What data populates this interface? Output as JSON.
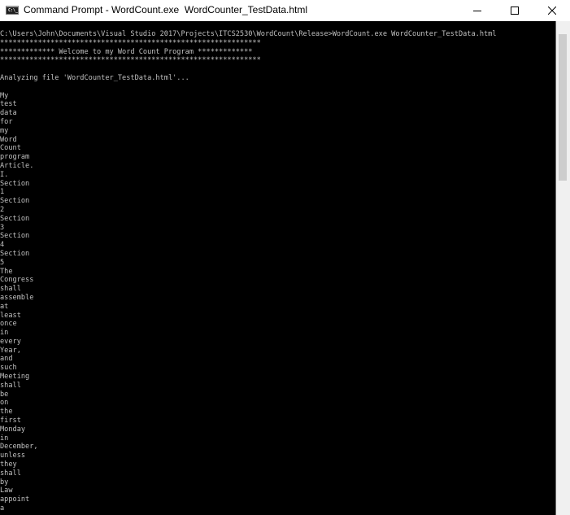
{
  "window": {
    "title": "Command Prompt - WordCount.exe  WordCounter_TestData.html",
    "icon": "cmd-icon",
    "icon_text": "C:\\_",
    "controls": {
      "minimize": "—",
      "maximize": "☐",
      "close": "✕"
    }
  },
  "console": {
    "background": "#000000",
    "text_color": "#c0c0c0",
    "lines": [
      "C:\\Users\\John\\Documents\\Visual Studio 2017\\Projects\\ITCS2530\\WordCount\\Release>WordCount.exe WordCounter_TestData.html",
      "**************************************************************",
      "************* Welcome to my Word Count Program *************",
      "**************************************************************",
      "",
      "Analyzing file 'WordCounter_TestData.html'...",
      "",
      "My",
      "test",
      "data",
      "for",
      "my",
      "Word",
      "Count",
      "program",
      "Article.",
      "I.",
      "Section",
      "1",
      "Section",
      "2",
      "Section",
      "3",
      "Section",
      "4",
      "Section",
      "5",
      "The",
      "Congress",
      "shall",
      "assemble",
      "at",
      "least",
      "once",
      "in",
      "every",
      "Year,",
      "and",
      "such",
      "Meeting",
      "shall",
      "be",
      "on",
      "the",
      "first",
      "Monday",
      "in",
      "December,",
      "unless",
      "they",
      "shall",
      "by",
      "Law",
      "appoint",
      "a"
    ]
  },
  "scrollbar": {
    "position_fraction": 0.0,
    "thumb_fraction": 0.3
  }
}
